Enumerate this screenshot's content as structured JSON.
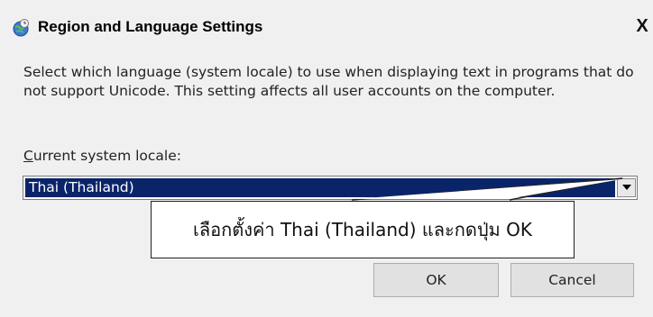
{
  "window": {
    "title": "Region and Language Settings",
    "close_label": "X"
  },
  "description": "Select which language (system locale) to use when displaying text in programs that do not support Unicode. This setting affects all user accounts on the computer.",
  "locale": {
    "label_accel": "C",
    "label_rest": "urrent system locale:",
    "selected_value": "Thai (Thailand)"
  },
  "callout": {
    "text": "เลือกตั้งค่า Thai (Thailand) และกดปุ่ม OK"
  },
  "buttons": {
    "ok_label": "OK",
    "cancel_label": "Cancel"
  },
  "icons": {
    "title_icon": "globe-clock-icon",
    "dropdown_icon": "chevron-down-icon"
  }
}
